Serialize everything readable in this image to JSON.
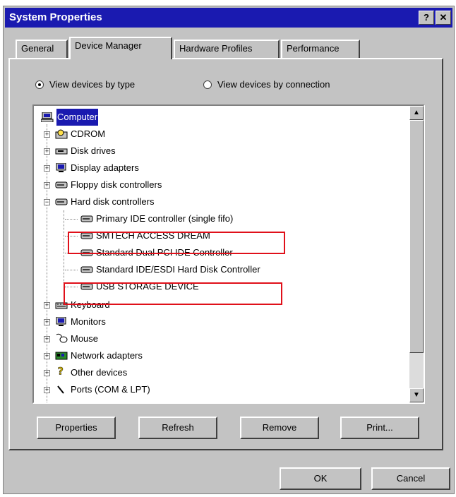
{
  "window": {
    "title": "System Properties",
    "help_btn": "?",
    "close_btn": "✕"
  },
  "tabs": [
    {
      "label": "General"
    },
    {
      "label": "Device Manager"
    },
    {
      "label": "Hardware Profiles"
    },
    {
      "label": "Performance"
    }
  ],
  "view": {
    "by_type": "View devices by type",
    "by_connection": "View devices by connection"
  },
  "tree": {
    "root": "Computer",
    "items": [
      "CDROM",
      "Disk drives",
      "Display adapters",
      "Floppy disk controllers",
      "Hard disk controllers",
      "Primary IDE controller (single fifo)",
      "SMTECH ACCESS DREAM",
      "Standard Dual PCI IDE Controller",
      "Standard IDE/ESDI Hard Disk Controller",
      "USB STORAGE DEVICE",
      "Keyboard",
      "Monitors",
      "Mouse",
      "Network adapters",
      "Other devices",
      "Ports (COM & LPT)"
    ]
  },
  "buttons": {
    "properties": "Properties",
    "refresh": "Refresh",
    "remove": "Remove",
    "print": "Print...",
    "ok": "OK",
    "cancel": "Cancel"
  },
  "scroll": {
    "up": "▲",
    "down": "▼"
  },
  "colors": {
    "title_bar": "#1a1ab0",
    "highlight_box": "#e0101a",
    "face": "#c3c3c3"
  }
}
